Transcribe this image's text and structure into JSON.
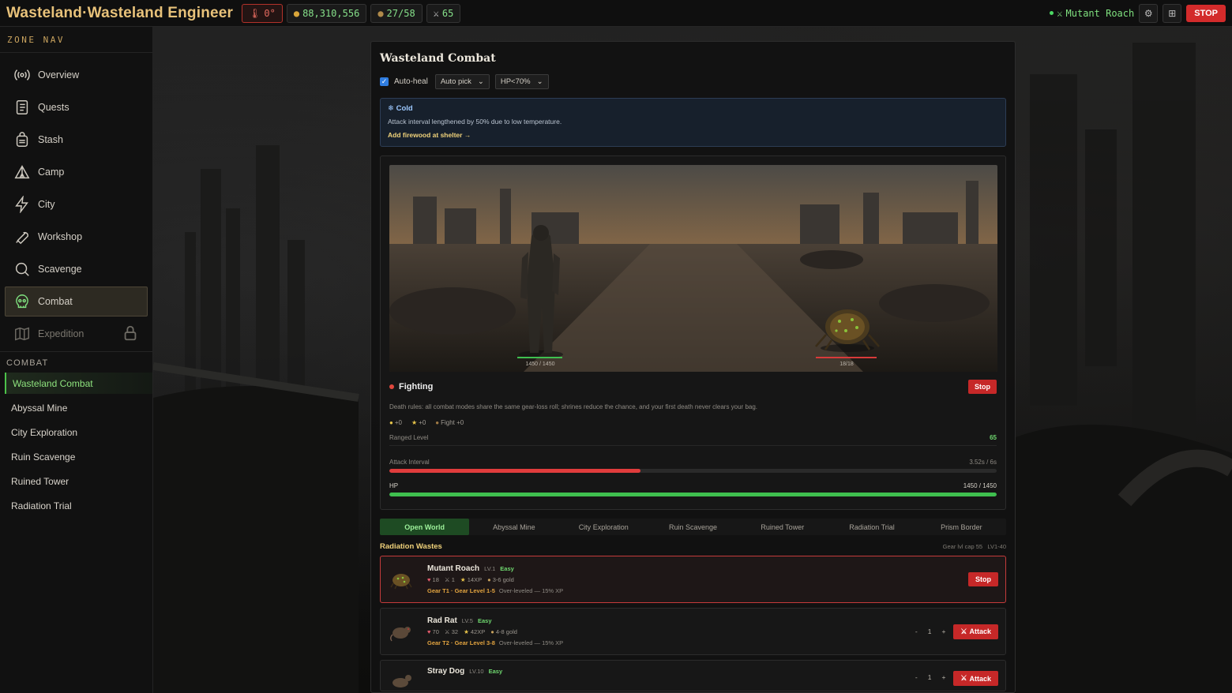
{
  "app": {
    "title": "Wasteland·Wasteland Engineer"
  },
  "topbar": {
    "temperature": "0°",
    "gold": "88,310,556",
    "capacity": "27/58",
    "combat_level": "65",
    "current_enemy": "Mutant Roach",
    "stop_label": "STOP"
  },
  "sidebar": {
    "title": "ZONE NAV",
    "items": [
      {
        "label": "Overview",
        "icon": "broadcast-icon"
      },
      {
        "label": "Quests",
        "icon": "scroll-icon"
      },
      {
        "label": "Stash",
        "icon": "backpack-icon"
      },
      {
        "label": "Camp",
        "icon": "tent-icon"
      },
      {
        "label": "City",
        "icon": "lightning-icon"
      },
      {
        "label": "Workshop",
        "icon": "wrench-icon"
      },
      {
        "label": "Scavenge",
        "icon": "search-icon"
      },
      {
        "label": "Combat",
        "icon": "skull-icon",
        "active": true
      },
      {
        "label": "Expedition",
        "icon": "map-icon",
        "locked": true
      }
    ],
    "combat_section": {
      "title": "COMBAT",
      "items": [
        "Wasteland Combat",
        "Abyssal Mine",
        "City Exploration",
        "Ruin Scavenge",
        "Ruined Tower",
        "Radiation Trial"
      ]
    }
  },
  "main": {
    "title": "Wasteland Combat",
    "auto_heal_label": "Auto-heal",
    "auto_heal_checked": true,
    "pick_select": "Auto pick",
    "threshold_select": "HP<70%",
    "cold": {
      "title": "Cold",
      "description": "Attack interval lengthened by 50% due to low temperature.",
      "link": "Add firewood at shelter →"
    },
    "battle": {
      "player_hp_label": "1450 / 1450",
      "enemy_hp_label": "18/18",
      "status": "Fighting",
      "stop_label": "Stop",
      "death_rules": "Death rules: all combat modes share the same gear-loss roll; shrines reduce the chance, and your first death never clears your bag.",
      "bonuses": [
        "+0",
        "+0",
        "Fight +0"
      ],
      "ranged_level_label": "Ranged Level",
      "ranged_level_value": "65",
      "attack_interval_label": "Attack Interval",
      "attack_interval_value": "3.52s / 6s",
      "attack_progress": 0.413,
      "hp_label": "HP",
      "hp_value": "1450 / 1450",
      "hp_progress": 1.0
    },
    "tabs": [
      "Open World",
      "Abyssal Mine",
      "City Exploration",
      "Ruin Scavenge",
      "Ruined Tower",
      "Radiation Trial",
      "Prism Border"
    ],
    "region": {
      "name": "Radiation Wastes",
      "gear_cap": "Gear lvl cap 55",
      "level_range": "LV1-40"
    },
    "enemies": [
      {
        "name": "Mutant Roach",
        "level": "LV.1",
        "difficulty": "Easy",
        "hp": "18",
        "atk": "1",
        "xp": "14XP",
        "gold": "3-6 gold",
        "gear": "Gear T1 · Gear Level 1-5",
        "note": "Over-leveled — 15% XP",
        "action": "Stop"
      },
      {
        "name": "Rad Rat",
        "level": "LV.5",
        "difficulty": "Easy",
        "hp": "70",
        "atk": "32",
        "xp": "42XP",
        "gold": "4-8 gold",
        "gear": "Gear T2 · Gear Level 3-8",
        "note": "Over-leveled — 15% XP",
        "qty": "1",
        "action": "Attack"
      },
      {
        "name": "Stray Dog",
        "level": "LV.10",
        "difficulty": "Easy",
        "qty": "1",
        "action": "Attack"
      }
    ]
  }
}
